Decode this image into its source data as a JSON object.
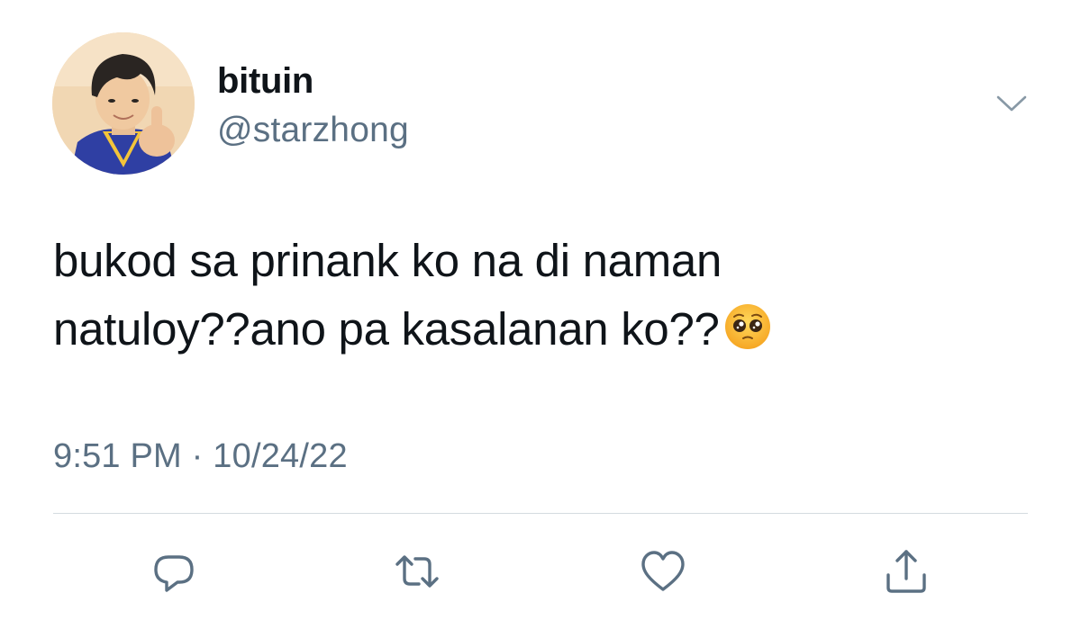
{
  "tweet": {
    "author": {
      "display_name": "bituin",
      "handle": "@starzhong"
    },
    "text_line1": "bukod sa prinank ko na di naman",
    "text_line2": "natuloy??ano pa kasalanan ko??",
    "emoji": "pleading-face-emoji",
    "timestamp": "9:51 PM · 10/24/22"
  },
  "icons": {
    "caret": "chevron-down-icon",
    "reply": "reply-icon",
    "retweet": "retweet-icon",
    "like": "heart-icon",
    "share": "share-icon"
  },
  "colors": {
    "text_primary": "#0f1419",
    "text_secondary": "#5b7083",
    "divider": "#d4dbe0",
    "icon": "#5b7083"
  }
}
